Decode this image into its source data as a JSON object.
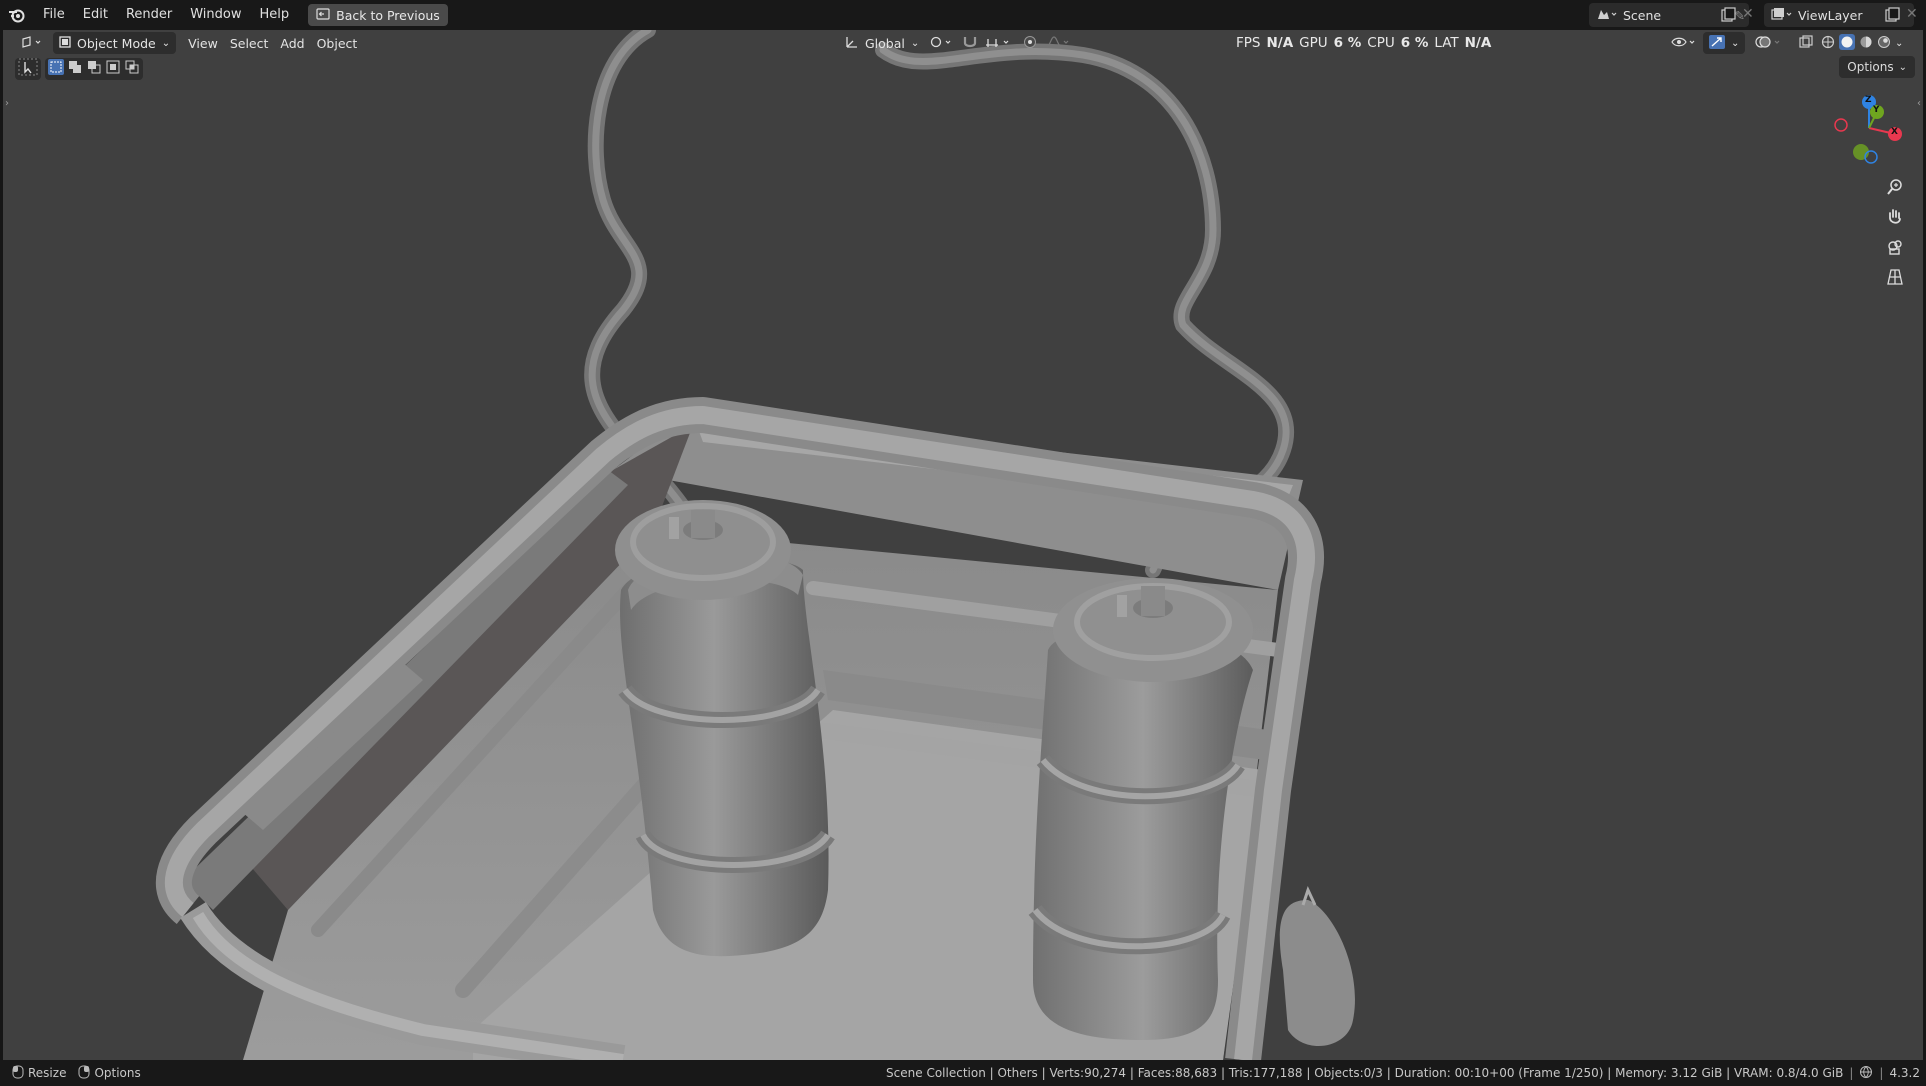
{
  "topbar": {
    "menus": [
      "File",
      "Edit",
      "Render",
      "Window",
      "Help"
    ],
    "back_button": "Back to Previous",
    "scene_name": "Scene",
    "view_layer": "ViewLayer"
  },
  "viewport_header": {
    "mode": "Object Mode",
    "menus": [
      "View",
      "Select",
      "Add",
      "Object"
    ],
    "orientation": "Global",
    "options_label": "Options"
  },
  "stats": {
    "fps_label": "FPS",
    "fps_value": "N/A",
    "gpu_label": "GPU",
    "gpu_value": "6 %",
    "cpu_label": "CPU",
    "cpu_value": "6 %",
    "lat_label": "LAT",
    "lat_value": "N/A"
  },
  "gizmo": {
    "x": "X",
    "y": "Y",
    "z": "Z"
  },
  "statusbar": {
    "resize": "Resize",
    "options": "Options",
    "info": "Scene Collection | Others | Verts:90,274 | Faces:88,683 | Tris:177,188 | Objects:0/3 | Duration: 00:10+00 (Frame 1/250) | Memory: 3.12 GiB | VRAM: 0.8/4.0 GiB",
    "version": "4.3.2"
  },
  "colors": {
    "viewport_bg": "#404040",
    "accent": "#4772b3",
    "axis_x": "#e8384f",
    "axis_y": "#6fa51f",
    "axis_z": "#2f83e2"
  }
}
